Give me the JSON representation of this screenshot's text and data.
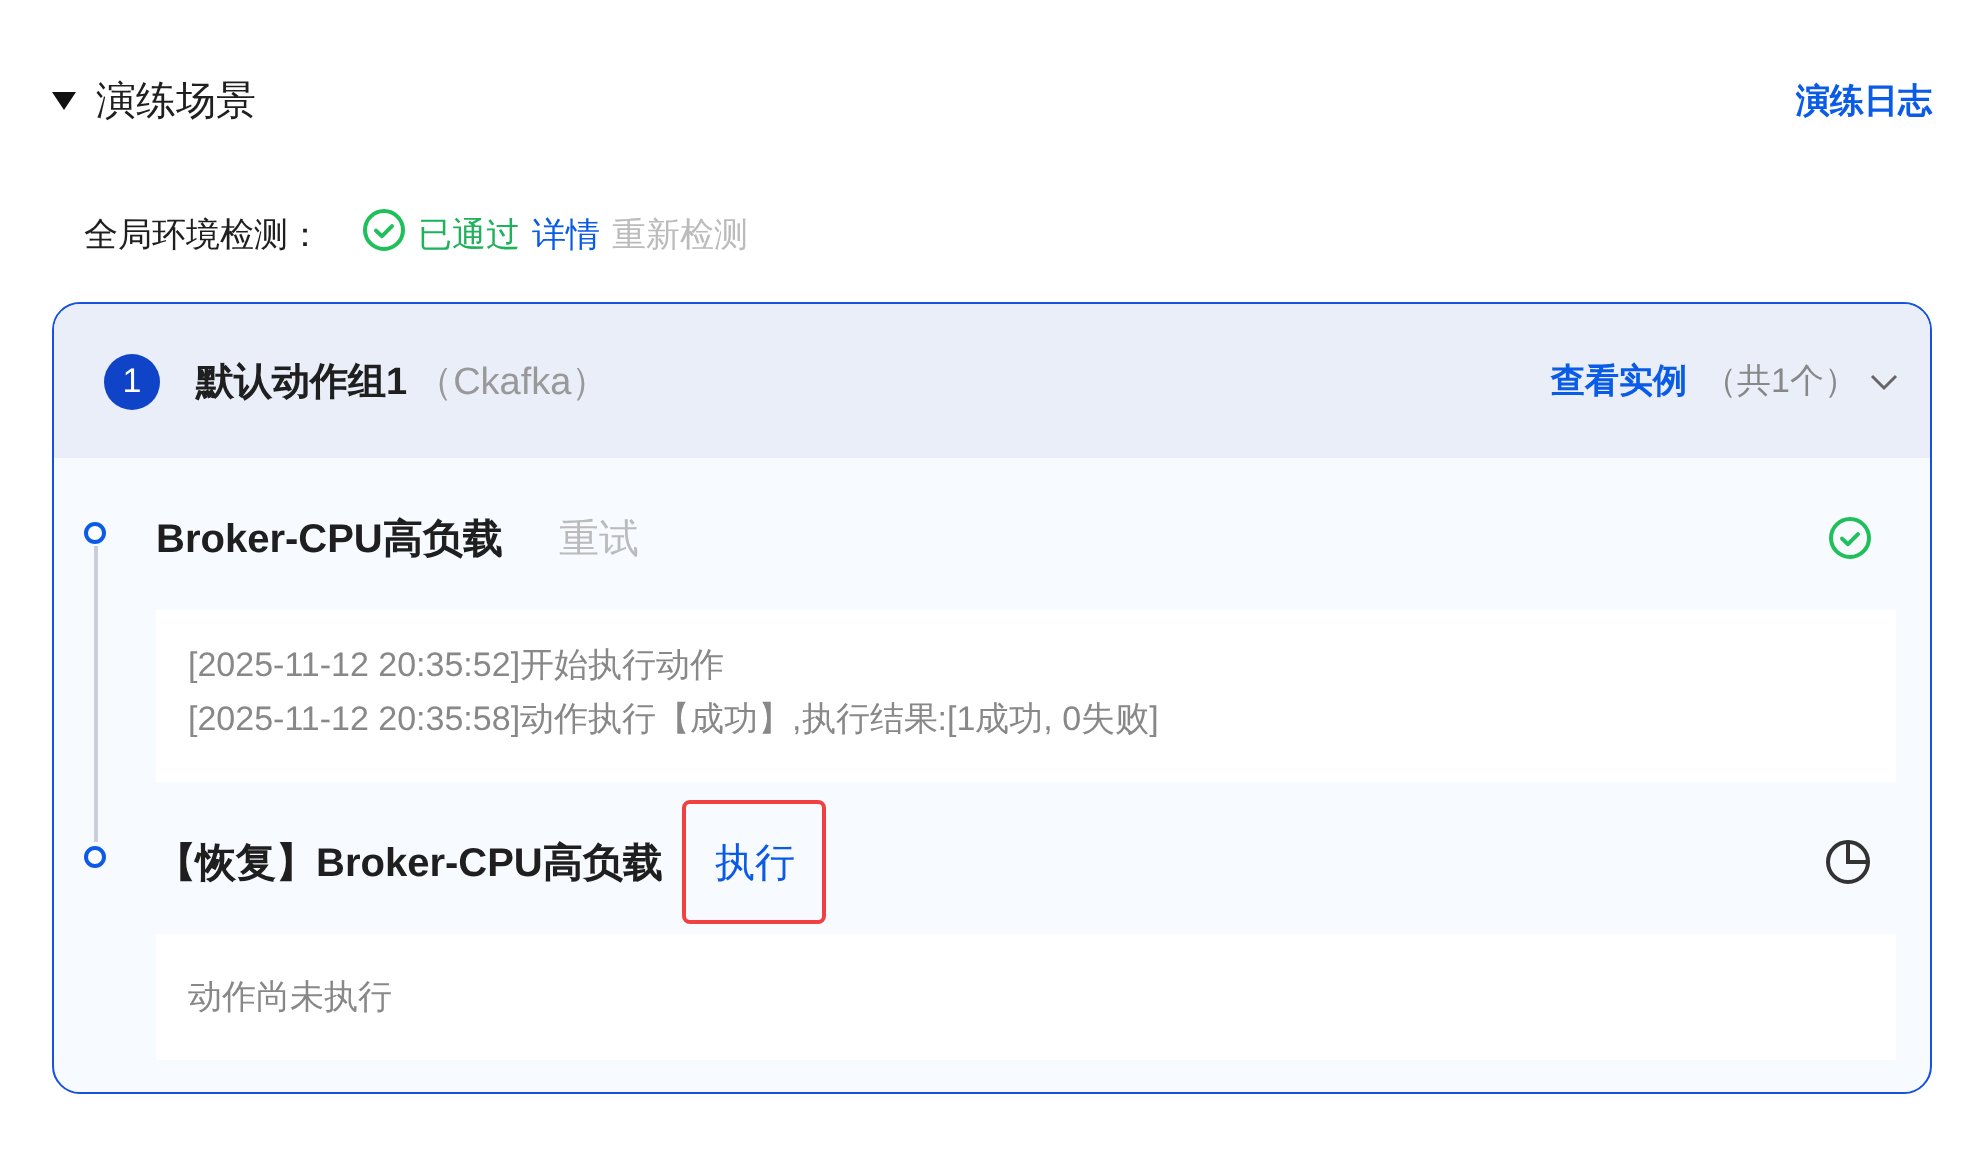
{
  "section": {
    "title": "演练场景",
    "expanded": true,
    "log_link": "演练日志"
  },
  "env_check": {
    "label": "全局环境检测：",
    "passed": true,
    "status_text": "已通过",
    "details_link": "详情",
    "recheck": {
      "label": "重新检测",
      "disabled": true
    }
  },
  "group": {
    "index": "1",
    "name": "默认动作组1",
    "type": "（Ckafka）",
    "instances_link": "查看实例",
    "instances_count": "（共1个）",
    "expanded": false,
    "steps": [
      {
        "title": "Broker-CPU高负载",
        "action": {
          "label": "重试",
          "disabled": true,
          "highlighted": false
        },
        "done": true,
        "log": [
          "[2025-11-12 20:35:52]开始执行动作",
          "[2025-11-12 20:35:58]动作执行【成功】,执行结果:[1成功, 0失败]"
        ]
      },
      {
        "title": "【恢复】Broker-CPU高负载",
        "action": {
          "label": "执行",
          "disabled": false,
          "highlighted": true
        },
        "done": false,
        "log": [
          "动作尚未执行"
        ]
      }
    ]
  }
}
